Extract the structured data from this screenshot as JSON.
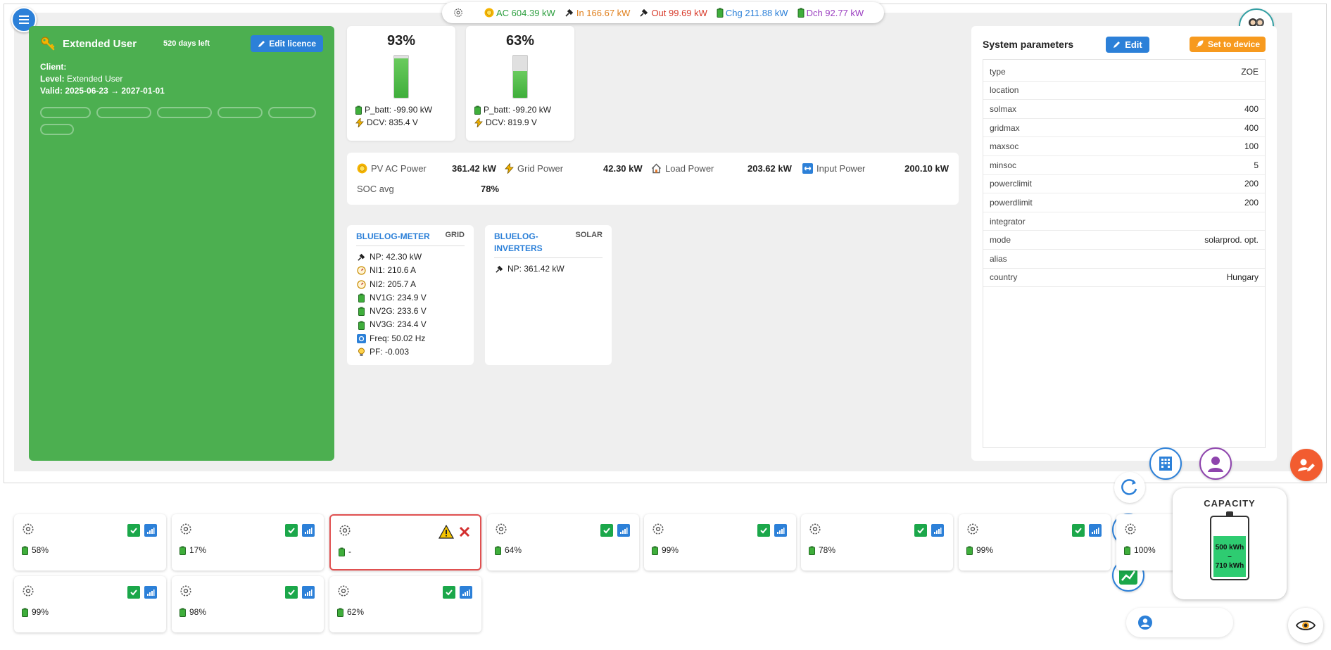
{
  "topbar": {
    "ac": "AC 604.39 kW",
    "in": "In 166.67 kW",
    "out": "Out 99.69 kW",
    "chg": "Chg 211.88 kW",
    "dch": "Dch 92.77 kW",
    "colors": {
      "ac": "#2c9e3e",
      "in": "#e0801e",
      "out": "#d83a2a",
      "chg": "#2c80d8",
      "dch": "#9b3fc0"
    }
  },
  "licence": {
    "title": "Extended User",
    "days_left": "520 days left",
    "edit_label": "Edit licence",
    "client_label": "Client:",
    "client_value": "",
    "level_label": "Level:",
    "level_value": "Extended User",
    "valid_label": "Valid:",
    "valid_value": "2025-06-23 → 2027-01-01"
  },
  "batteries": [
    {
      "pct": "93%",
      "level": 0.93,
      "p_batt": "P_batt: -99.90 kW",
      "dcv": "DCV: 835.4 V"
    },
    {
      "pct": "63%",
      "level": 0.63,
      "p_batt": "P_batt: -99.20 kW",
      "dcv": "DCV: 819.9 V"
    }
  ],
  "summary": {
    "pv_label": "PV AC Power",
    "pv_value": "361.42 kW",
    "grid_label": "Grid Power",
    "grid_value": "42.30 kW",
    "load_label": "Load Power",
    "load_value": "203.62 kW",
    "input_label": "Input Power",
    "input_value": "200.10 kW",
    "soc_label": "SOC avg",
    "soc_value": "78%"
  },
  "meter": {
    "name": "BLUELOG-METER",
    "tag": "GRID",
    "rows": [
      "NP: 42.30 kW",
      "NI1: 210.6 A",
      "NI2: 205.7 A",
      "NV1G: 234.9 V",
      "NV2G: 233.6 V",
      "NV3G: 234.4 V",
      "Freq: 50.02 Hz",
      "PF: -0.003"
    ]
  },
  "inverters_device": {
    "name_line1": "BLUELOG-",
    "name_line2": "INVERTERS",
    "tag": "SOLAR",
    "rows": [
      "NP: 361.42 kW"
    ]
  },
  "system_params": {
    "title": "System parameters",
    "edit_label": "Edit",
    "set_label": "Set to device",
    "rows": [
      {
        "k": "type",
        "v": "ZOE"
      },
      {
        "k": "location",
        "v": ""
      },
      {
        "k": "solmax",
        "v": "400"
      },
      {
        "k": "gridmax",
        "v": "400"
      },
      {
        "k": "maxsoc",
        "v": "100"
      },
      {
        "k": "minsoc",
        "v": "5"
      },
      {
        "k": "powerclimit",
        "v": "200"
      },
      {
        "k": "powerdlimit",
        "v": "200"
      },
      {
        "k": "integrator",
        "v": ""
      },
      {
        "k": "mode",
        "v": "solarprod. opt."
      },
      {
        "k": "alias",
        "v": ""
      },
      {
        "k": "country",
        "v": "Hungary"
      }
    ]
  },
  "units": [
    {
      "soc": "58%",
      "status": "ok"
    },
    {
      "soc": "17%",
      "status": "ok"
    },
    {
      "soc": "-",
      "status": "error"
    },
    {
      "soc": "64%",
      "status": "ok"
    },
    {
      "soc": "99%",
      "status": "ok"
    },
    {
      "soc": "78%",
      "status": "ok"
    },
    {
      "soc": "99%",
      "status": "ok"
    },
    {
      "soc": "100%",
      "status": "ok"
    },
    {
      "soc": "99%",
      "status": "ok"
    },
    {
      "soc": "98%",
      "status": "ok"
    },
    {
      "soc": "62%",
      "status": "ok"
    }
  ],
  "capacity": {
    "title": "CAPACITY",
    "line1": "500 kWh",
    "line2": "–",
    "line3": "710 kWh"
  }
}
